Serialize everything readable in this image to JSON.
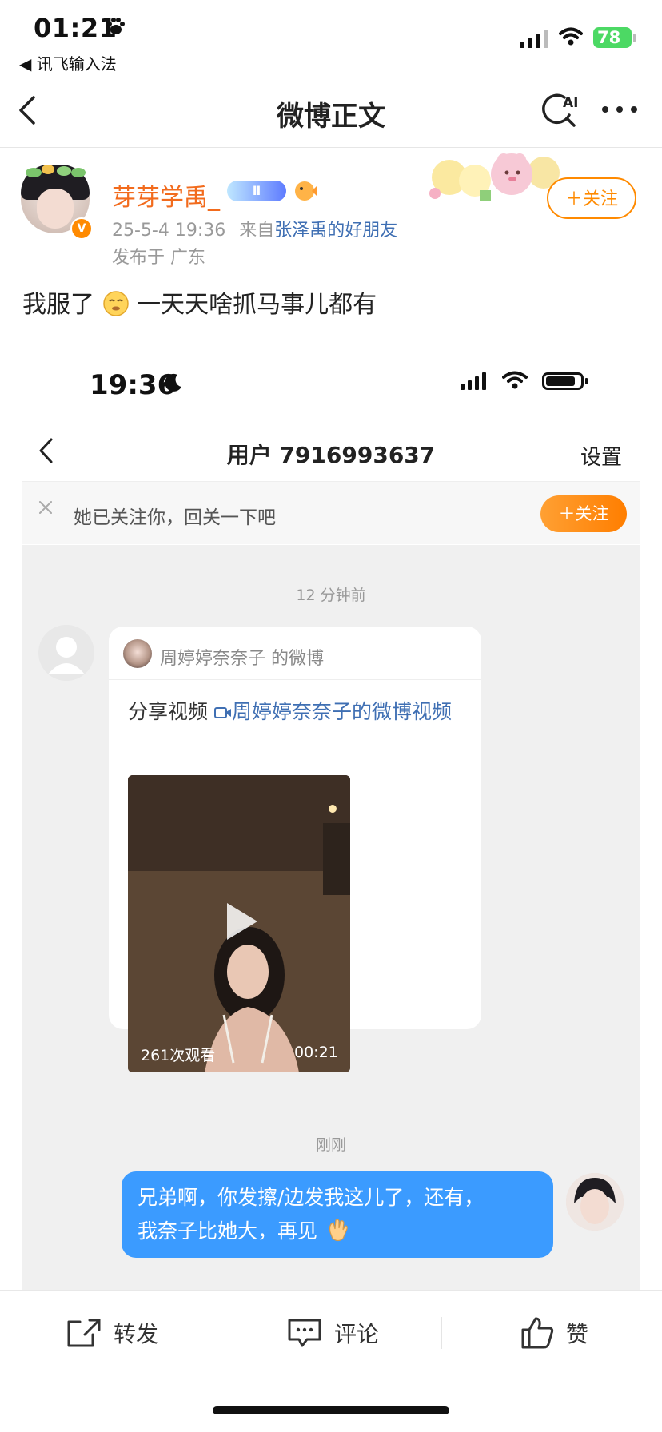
{
  "status_bar": {
    "time": "01:21",
    "back_app": "◀ 讯飞输入法",
    "battery": "78"
  },
  "nav": {
    "title": "微博正文",
    "ai_label": "AI"
  },
  "post": {
    "author": "芽芽学禹_",
    "level": "Ⅱ",
    "verified_mark": "V",
    "date": "25-5-4 19:36",
    "source_prefix": "来自",
    "source": "张泽禹的好朋友",
    "location": "发布于 广东",
    "follow_label": "＋关注",
    "text_before_emoji": "我服了",
    "text_after_emoji": "一天天啥抓马事儿都有"
  },
  "screenshot": {
    "time": "19:36",
    "nav_title": "用户 7916993637",
    "settings": "设置",
    "notice": "她已关注你，回关一下吧",
    "notice_follow": "＋关注",
    "ts1": "12 分钟前",
    "card_head": "周婷婷奈奈子 的微博",
    "card_text_prefix": "分享视频 ",
    "card_link": "周婷婷奈奈子的微博视频",
    "video_views": "261次观看",
    "video_duration": "00:21",
    "ts2": "刚刚",
    "my_message_line1": "兄弟啊，你发擦/边发我这儿了，还有，",
    "my_message_line2": "我奈子比她大，再见"
  },
  "bottom_bar": {
    "repost": "转发",
    "comment": "评论",
    "like": "赞"
  },
  "colors": {
    "accent_orange": "#ff8a00",
    "link_blue": "#3f6fb3",
    "bubble_blue": "#3b9bff"
  }
}
